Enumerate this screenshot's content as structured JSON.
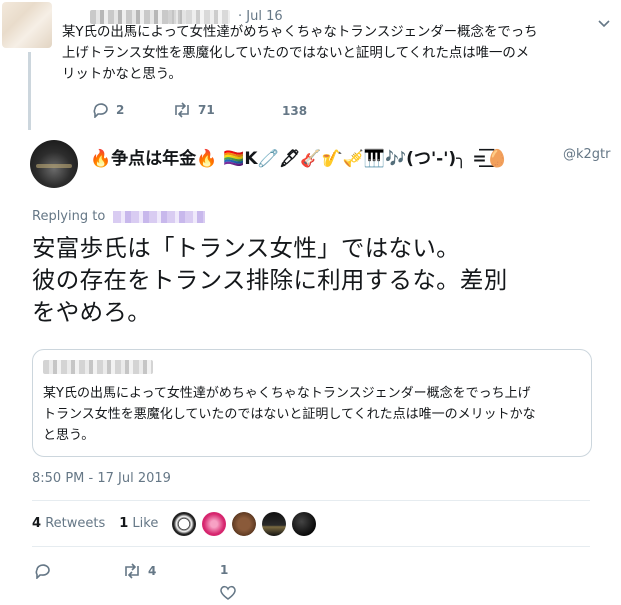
{
  "parent_tweet": {
    "date": "· Jul 16",
    "text": "某Y氏の出馬によって女性達がめちゃくちゃなトランスジェンダー概念をでっち\n上げトランス女性を悪魔化していたのではないと証明してくれた点は唯一のメ\nリットかなと思う。",
    "actions": {
      "replies": "2",
      "retweets": "71",
      "likes": "138"
    }
  },
  "main_tweet": {
    "display_name": "🔥争点は年金🔥 🏳️‍🌈K🧷🖋🎸🎷🎺🎹🎶(つ'-')╮ =͟͟͞͞🥚",
    "handle": "@k2gtr",
    "replying_to": "Replying to",
    "text": "安富歩氏は「トランス女性」ではない。\n彼の存在をトランス排除に利用するな。差別\nをやめろ。",
    "quoted_tweet": {
      "text": "某Y氏の出馬によって女性達がめちゃくちゃなトランスジェンダー概念をでっち上げ\nトランス女性を悪魔化していたのではないと証明してくれた点は唯一のメリットかな\nと思う。"
    },
    "timestamp": "8:50 PM - 17 Jul 2019",
    "retweets_count": "4",
    "retweets_label": "Retweets",
    "likes_count": "1",
    "likes_label": "Like",
    "actions": {
      "replies": "",
      "retweets": "4",
      "likes": "1"
    }
  },
  "colors": {
    "muted": "#657786",
    "border": "#ccd6dd",
    "text": "#14171a"
  }
}
